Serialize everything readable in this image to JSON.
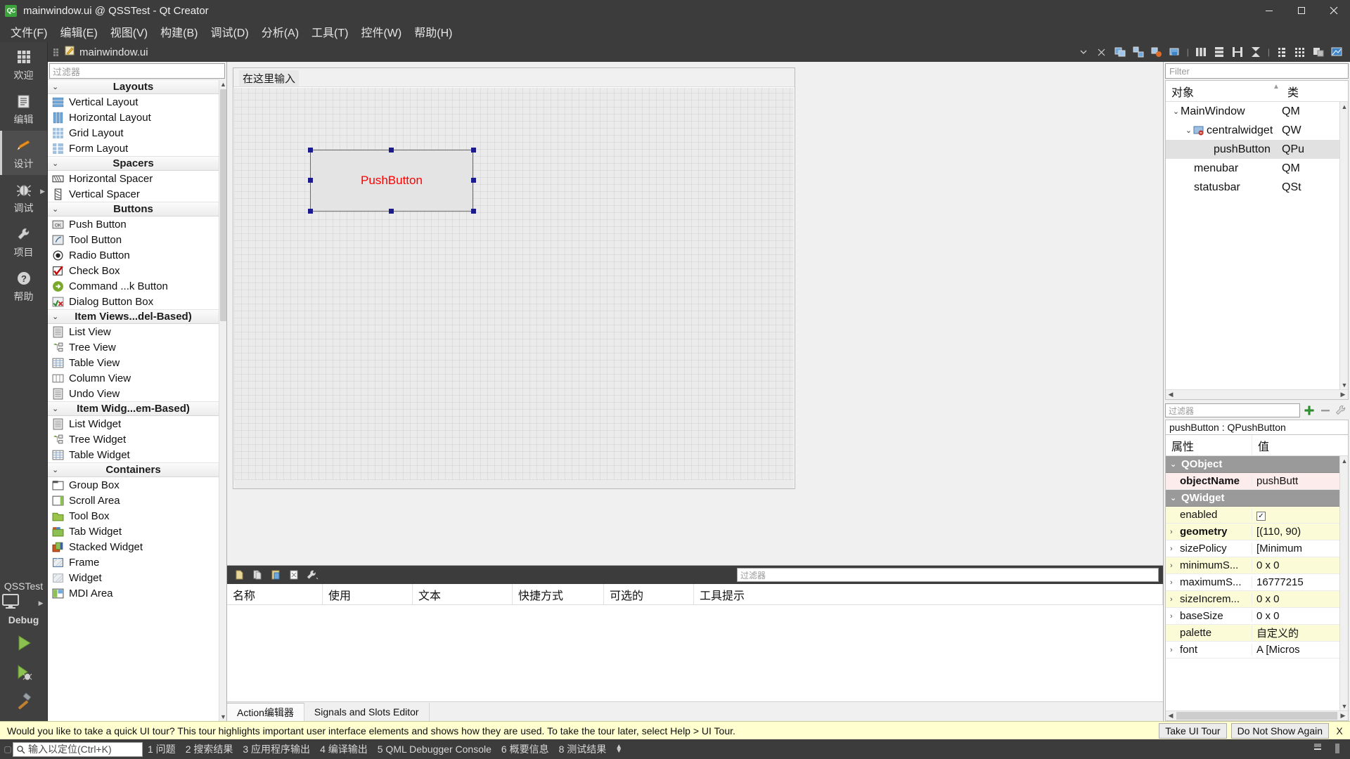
{
  "window": {
    "title": "mainwindow.ui @ QSSTest - Qt Creator",
    "logo_text": "QC",
    "minimize": "─",
    "maximize": "☐",
    "close": "✕"
  },
  "menubar": {
    "items": [
      {
        "label": "文件(F)"
      },
      {
        "label": "编辑(E)"
      },
      {
        "label": "视图(V)"
      },
      {
        "label": "构建(B)"
      },
      {
        "label": "调试(D)"
      },
      {
        "label": "分析(A)"
      },
      {
        "label": "工具(T)"
      },
      {
        "label": "控件(W)"
      },
      {
        "label": "帮助(H)"
      }
    ]
  },
  "modebar": {
    "items": [
      {
        "label": "欢迎",
        "icon": "grid-icon",
        "active": false,
        "arrow": false
      },
      {
        "label": "编辑",
        "icon": "document-icon",
        "active": false,
        "arrow": false
      },
      {
        "label": "设计",
        "icon": "pencil-icon",
        "active": true,
        "arrow": false
      },
      {
        "label": "调试",
        "icon": "bug-icon",
        "active": false,
        "arrow": true
      },
      {
        "label": "项目",
        "icon": "wrench-icon",
        "active": false,
        "arrow": false
      },
      {
        "label": "帮助",
        "icon": "help-icon",
        "active": false,
        "arrow": false
      }
    ],
    "kit": {
      "project": "QSSTest",
      "config": "Debug",
      "monitor_icon": "monitor-icon"
    },
    "run_buttons": [
      {
        "name": "run-button",
        "icon": "play-green-icon"
      },
      {
        "name": "debug-button",
        "icon": "play-debug-icon"
      },
      {
        "name": "build-button",
        "icon": "hammer-icon"
      }
    ]
  },
  "editor_tabbar": {
    "document": "mainwindow.ui",
    "dropdown_icon": "chevron-down-icon",
    "close_icon": "close-icon",
    "tools": [
      "edit-widgets-icon",
      "edit-signals-slots-icon",
      "edit-buddies-icon",
      "edit-tab-order-icon",
      "layout-horizontal-icon",
      "layout-vertical-icon",
      "layout-splitter-h-icon",
      "layout-splitter-v-icon",
      "layout-form-icon",
      "layout-grid-icon",
      "break-layout-icon",
      "adjust-size-icon"
    ]
  },
  "widgetbox": {
    "filter_placeholder": "过滤器",
    "groups": [
      {
        "title": "Layouts",
        "items": [
          {
            "label": "Vertical Layout",
            "icon": "vertical-layout-icon"
          },
          {
            "label": "Horizontal Layout",
            "icon": "horizontal-layout-icon"
          },
          {
            "label": "Grid Layout",
            "icon": "grid-layout-icon"
          },
          {
            "label": "Form Layout",
            "icon": "form-layout-icon"
          }
        ]
      },
      {
        "title": "Spacers",
        "items": [
          {
            "label": "Horizontal Spacer",
            "icon": "horizontal-spacer-icon"
          },
          {
            "label": "Vertical Spacer",
            "icon": "vertical-spacer-icon"
          }
        ]
      },
      {
        "title": "Buttons",
        "items": [
          {
            "label": "Push Button",
            "icon": "push-button-icon"
          },
          {
            "label": "Tool Button",
            "icon": "tool-button-icon"
          },
          {
            "label": "Radio Button",
            "icon": "radio-button-icon"
          },
          {
            "label": "Check Box",
            "icon": "check-box-icon"
          },
          {
            "label": "Command ...k Button",
            "icon": "command-link-icon"
          },
          {
            "label": "Dialog Button Box",
            "icon": "dialog-button-box-icon"
          }
        ]
      },
      {
        "title": "Item Views...del-Based)",
        "items": [
          {
            "label": "List View",
            "icon": "list-view-icon"
          },
          {
            "label": "Tree View",
            "icon": "tree-view-icon"
          },
          {
            "label": "Table View",
            "icon": "table-view-icon"
          },
          {
            "label": "Column View",
            "icon": "column-view-icon"
          },
          {
            "label": "Undo View",
            "icon": "undo-view-icon"
          }
        ]
      },
      {
        "title": "Item Widg...em-Based)",
        "items": [
          {
            "label": "List Widget",
            "icon": "list-widget-icon"
          },
          {
            "label": "Tree Widget",
            "icon": "tree-widget-icon"
          },
          {
            "label": "Table Widget",
            "icon": "table-widget-icon"
          }
        ]
      },
      {
        "title": "Containers",
        "items": [
          {
            "label": "Group Box",
            "icon": "group-box-icon"
          },
          {
            "label": "Scroll Area",
            "icon": "scroll-area-icon"
          },
          {
            "label": "Tool Box",
            "icon": "tool-box-icon"
          },
          {
            "label": "Tab Widget",
            "icon": "tab-widget-icon"
          },
          {
            "label": "Stacked Widget",
            "icon": "stacked-widget-icon"
          },
          {
            "label": "Frame",
            "icon": "frame-icon"
          },
          {
            "label": "Widget",
            "icon": "widget-icon"
          },
          {
            "label": "MDI Area",
            "icon": "mdi-area-icon"
          }
        ]
      }
    ]
  },
  "canvas": {
    "menu_placeholder": "在这里输入",
    "selected_widget": {
      "text": "PushButton",
      "text_color": "#ff0000"
    }
  },
  "action_editor": {
    "toolbar_icons": [
      "new-action-icon",
      "copy-action-icon",
      "paste-action-icon",
      "delete-action-icon",
      "configure-icon"
    ],
    "filter_placeholder": "过滤器",
    "columns": [
      "名称",
      "使用",
      "文本",
      "快捷方式",
      "可选的",
      "工具提示"
    ],
    "rows": [],
    "tabs": [
      {
        "label": "Action编辑器",
        "active": true
      },
      {
        "label": "Signals and Slots Editor",
        "active": false
      }
    ]
  },
  "object_inspector": {
    "filter_placeholder": "Filter",
    "columns": [
      "对象",
      "类"
    ],
    "rows": [
      {
        "name": "MainWindow",
        "class": "QM",
        "indent": 0,
        "expander": "⌄",
        "icon": "",
        "selected": false
      },
      {
        "name": "centralwidget",
        "class": "QW",
        "indent": 1,
        "expander": "⌄",
        "icon": "widget-icon",
        "selected": false
      },
      {
        "name": "pushButton",
        "class": "QPu",
        "indent": 2,
        "expander": "",
        "icon": "",
        "selected": true
      },
      {
        "name": "menubar",
        "class": "QM",
        "indent": 1,
        "expander": "",
        "icon": "",
        "selected": false
      },
      {
        "name": "statusbar",
        "class": "QSt",
        "indent": 1,
        "expander": "",
        "icon": "",
        "selected": false
      }
    ]
  },
  "property_editor": {
    "filter_placeholder": "过滤器",
    "toolbar_icons": [
      "add-property-icon",
      "remove-property-icon",
      "configure-property-icon"
    ],
    "object_line": "pushButton : QPushButton",
    "columns": [
      "属性",
      "值"
    ],
    "rows": [
      {
        "type": "group",
        "name": "QObject",
        "value": ""
      },
      {
        "type": "prop",
        "name": "objectName",
        "value": "pushButt",
        "bg": "pink",
        "bold": true,
        "expander": false,
        "checkbox": false
      },
      {
        "type": "group",
        "name": "QWidget",
        "value": ""
      },
      {
        "type": "prop",
        "name": "enabled",
        "value": "",
        "bg": "yellow",
        "bold": false,
        "expander": false,
        "checkbox": true
      },
      {
        "type": "prop",
        "name": "geometry",
        "value": "[(110, 90)",
        "bg": "yellow",
        "bold": true,
        "expander": true,
        "checkbox": false
      },
      {
        "type": "prop",
        "name": "sizePolicy",
        "value": "[Minimum",
        "bg": "white",
        "bold": false,
        "expander": true,
        "checkbox": false
      },
      {
        "type": "prop",
        "name": "minimumS...",
        "value": "0 x 0",
        "bg": "yellow",
        "bold": false,
        "expander": true,
        "checkbox": false
      },
      {
        "type": "prop",
        "name": "maximumS...",
        "value": "16777215",
        "bg": "white",
        "bold": false,
        "expander": true,
        "checkbox": false
      },
      {
        "type": "prop",
        "name": "sizeIncrem...",
        "value": "0 x 0",
        "bg": "yellow",
        "bold": false,
        "expander": true,
        "checkbox": false
      },
      {
        "type": "prop",
        "name": "baseSize",
        "value": "0 x 0",
        "bg": "white",
        "bold": false,
        "expander": true,
        "checkbox": false
      },
      {
        "type": "prop",
        "name": "palette",
        "value": "自定义的",
        "bg": "yellow",
        "bold": false,
        "expander": false,
        "checkbox": false
      },
      {
        "type": "prop",
        "name": "font",
        "value": "A [Micros",
        "bg": "white",
        "bold": false,
        "expander": true,
        "checkbox": false
      }
    ]
  },
  "tour_banner": {
    "message": "Would you like to take a quick UI tour? This tour highlights important user interface elements and shows how they are used. To take the tour later, select Help > UI Tour.",
    "take_tour": "Take UI Tour",
    "dismiss": "Do Not Show Again",
    "close": "X"
  },
  "statusbar": {
    "locator_placeholder": "输入以定位(Ctrl+K)",
    "locator_icon": "search-icon",
    "items": [
      "1 问题",
      "2 搜索结果",
      "3 应用程序输出",
      "4 编译输出",
      "5 QML Debugger Console",
      "6 概要信息",
      "8 测试结果"
    ]
  },
  "colors": {
    "chrome": "#3c3c3c",
    "accent_red": "#ff0000",
    "banner_bg": "#ffffd0",
    "prop_yellow": "#fbfbd8"
  }
}
